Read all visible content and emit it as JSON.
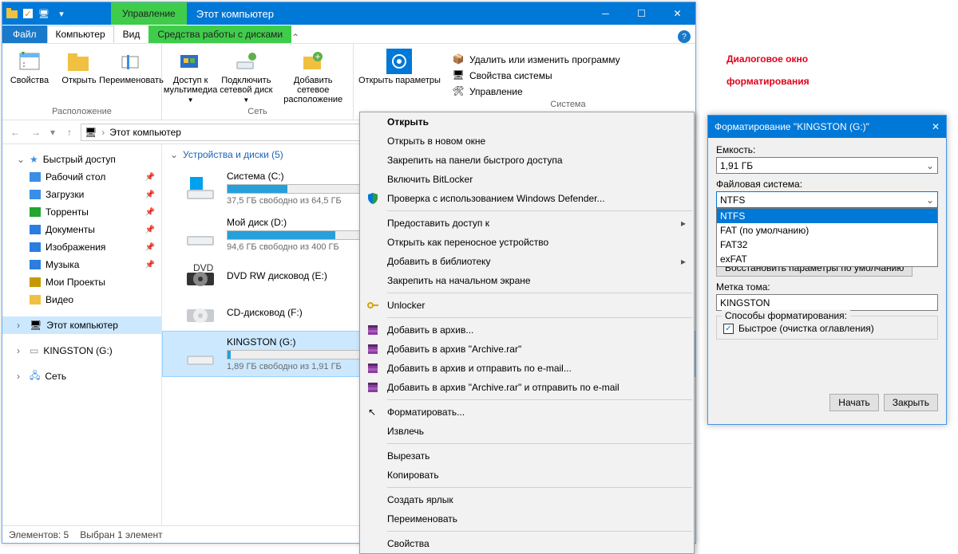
{
  "title": "Этот компьютер",
  "contextTab": "Управление",
  "tabs": {
    "file": "Файл",
    "computer": "Компьютер",
    "view": "Вид",
    "drive": "Средства работы с дисками"
  },
  "ribbon": {
    "location": {
      "label": "Расположение",
      "props": "Свойства",
      "open": "Открыть",
      "rename": "Переименовать"
    },
    "network": {
      "label": "Сеть",
      "media": "Доступ к мультимедиа",
      "mapdrive": "Подключить сетевой диск",
      "addloc": "Добавить сетевое расположение"
    },
    "settings": {
      "open": "Открыть параметры",
      "uninstall": "Удалить или изменить программу",
      "sysprops": "Свойства системы",
      "manage": "Управление",
      "group": "Система"
    }
  },
  "address": "Этот компьютер",
  "sidebar": {
    "quick": "Быстрый доступ",
    "items": [
      {
        "label": "Рабочий стол",
        "color": "#3a8ee6",
        "pin": true
      },
      {
        "label": "Загрузки",
        "color": "#3a8ee6",
        "pin": true
      },
      {
        "label": "Торренты",
        "color": "#24a52f",
        "pin": true
      },
      {
        "label": "Документы",
        "color": "#2b7de1",
        "pin": true
      },
      {
        "label": "Изображения",
        "color": "#2b7de1",
        "pin": true
      },
      {
        "label": "Музыка",
        "color": "#2b7de1",
        "pin": true
      },
      {
        "label": "Мои Проекты",
        "color": "#c59a00",
        "pin": false
      },
      {
        "label": "Видео",
        "color": "#f0c040",
        "pin": false
      }
    ],
    "thispc": "Этот компьютер",
    "kingston": "KINGSTON (G:)",
    "network": "Сеть"
  },
  "section": "Устройства и диски (5)",
  "drives": [
    {
      "name": "Система (C:)",
      "sub": "37,5 ГБ свободно из 64,5 ГБ",
      "fill": 42,
      "type": "win"
    },
    {
      "name": "Мой диск (D:)",
      "sub": "94,6 ГБ свободно из 400 ГБ",
      "fill": 76,
      "type": "hdd"
    },
    {
      "name": "DVD RW дисковод (E:)",
      "sub": "",
      "fill": -1,
      "type": "dvd"
    },
    {
      "name": "CD-дисковод (F:)",
      "sub": "",
      "fill": -1,
      "type": "cd"
    },
    {
      "name": "KINGSTON (G:)",
      "sub": "1,89 ГБ свободно из 1,91 ГБ",
      "fill": 2,
      "type": "usb",
      "sel": true
    }
  ],
  "status": {
    "count": "Элементов: 5",
    "sel": "Выбран 1 элемент"
  },
  "ctx": [
    {
      "t": "Открыть",
      "bold": true
    },
    {
      "t": "Открыть в новом окне"
    },
    {
      "t": "Закрепить на панели быстрого доступа"
    },
    {
      "t": "Включить BitLocker"
    },
    {
      "t": "Проверка с использованием Windows Defender...",
      "icon": "shield"
    },
    {
      "sep": true
    },
    {
      "t": "Предоставить доступ к",
      "sub": true
    },
    {
      "t": "Открыть как переносное устройство"
    },
    {
      "t": "Добавить в библиотеку",
      "sub": true
    },
    {
      "t": "Закрепить на начальном экране"
    },
    {
      "sep": true
    },
    {
      "t": "Unlocker",
      "icon": "key"
    },
    {
      "sep": true
    },
    {
      "t": "Добавить в архив...",
      "icon": "rar"
    },
    {
      "t": "Добавить в архив \"Archive.rar\"",
      "icon": "rar"
    },
    {
      "t": "Добавить в архив и отправить по e-mail...",
      "icon": "rar"
    },
    {
      "t": "Добавить в архив \"Archive.rar\" и отправить по e-mail",
      "icon": "rar"
    },
    {
      "sep": true
    },
    {
      "t": "Форматировать...",
      "cursor": true
    },
    {
      "t": "Извлечь"
    },
    {
      "sep": true
    },
    {
      "t": "Вырезать"
    },
    {
      "t": "Копировать"
    },
    {
      "sep": true
    },
    {
      "t": "Создать ярлык"
    },
    {
      "t": "Переименовать"
    },
    {
      "sep": true
    },
    {
      "t": "Свойства"
    }
  ],
  "callout": {
    "l1": "Диалоговое окно",
    "l2": "форматирования"
  },
  "fmt": {
    "title": "Форматирование \"KINGSTON (G:)\"",
    "capacity": {
      "label": "Емкость:",
      "value": "1,91 ГБ"
    },
    "fs": {
      "label": "Файловая система:",
      "value": "NTFS",
      "opts": [
        "NTFS",
        "FAT (по умолчанию)",
        "FAT32",
        "exFAT"
      ]
    },
    "restore": "Восстановить параметры по умолчанию",
    "vol": {
      "label": "Метка тома:",
      "value": "KINGSTON"
    },
    "ways": {
      "label": "Способы форматирования:",
      "quick": "Быстрое (очистка оглавления)"
    },
    "start": "Начать",
    "close": "Закрыть"
  }
}
